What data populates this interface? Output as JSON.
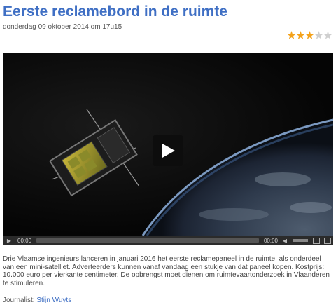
{
  "article": {
    "title": "Eerste reclamebord in de ruimte",
    "date": "donderdag 09 oktober 2014 om 17u15",
    "rating": 3,
    "rating_max": 5,
    "description": "Drie Vlaamse ingenieurs lanceren in januari 2016 het eerste reclamepaneel in de ruimte, als onderdeel van een mini-satelliet. Adverteerders kunnen vanaf vandaag een stukje van dat paneel kopen. Kostprijs: 10.000 euro per vierkante centimeter. De opbrengst moet dienen om ruimtevaartonderzoek in Vlaanderen te stimuleren.",
    "journalist_label": "Journalist:",
    "journalist_name": "Stijn Wuyts"
  },
  "player": {
    "current_time": "00:00",
    "duration": "00:00",
    "progress": 0
  },
  "colors": {
    "title": "#3f6fc4",
    "star_on": "#f4a21a",
    "star_off": "#cfcfcf"
  }
}
